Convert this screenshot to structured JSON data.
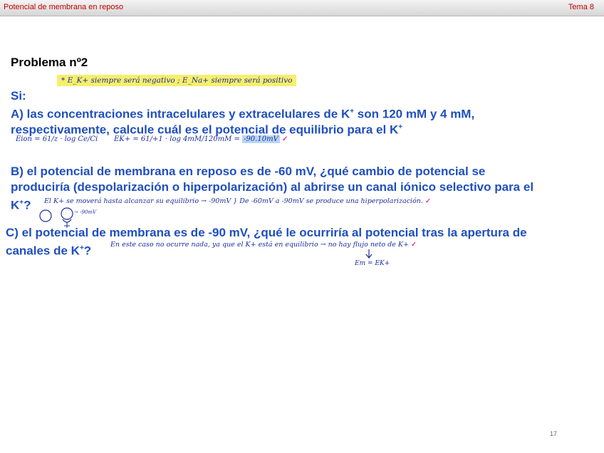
{
  "header": {
    "title": "Potencial de membrana en reposo",
    "section": "Tema 8"
  },
  "problem_title": "Problema nº2",
  "note": "* E_K+ siempre será negativo ; E_Na+ siempre será positivo",
  "si_label": "Si:",
  "question_a": {
    "line1": "A) las concentraciones intracelulares y extracelulares de K",
    "line1_sup": "+",
    "line1_end": " son 120 mM y 4 mM,",
    "line2": "respectivamente, calcule cuál es el potencial de equilibrio para el K",
    "line2_sup": "+"
  },
  "answer_a": {
    "formula1": "Eion = 61/z · log Ce/Ci",
    "formula2": "EK+ = 61/+1 · log 4mM/120mM =",
    "result": "-90.10mV",
    "check": "✓"
  },
  "question_b": {
    "line1": "B) el potencial de membrana en reposo es de -60 mV, ¿qué cambio de potencial se",
    "line2": "produciría (despolarización o hiperpolarización) al abrirse un canal iónico selectivo para el",
    "line3": "K",
    "line3_sup": "+",
    "line3_end": "?"
  },
  "answer_b": {
    "text": "El K+ se moverá hasta alcanzar su equilibrio → -90mV } De -60mV a -90mV se produce una hiperpolarización.",
    "check": "✓",
    "diagram_label": "→ -90mV"
  },
  "question_c": {
    "line1": "C) el potencial de membrana es de -90 mV, ¿qué le ocurriría al potencial tras la apertura de",
    "line2": "canales de K",
    "line2_sup": "+",
    "line2_end": "?"
  },
  "answer_c": {
    "text": "En este caso no ocurre nada, ya que el K+ está en equilibrio → no hay flujo neto de K+",
    "check": "✓",
    "sub": "Em = EK+"
  },
  "page_number": "17"
}
